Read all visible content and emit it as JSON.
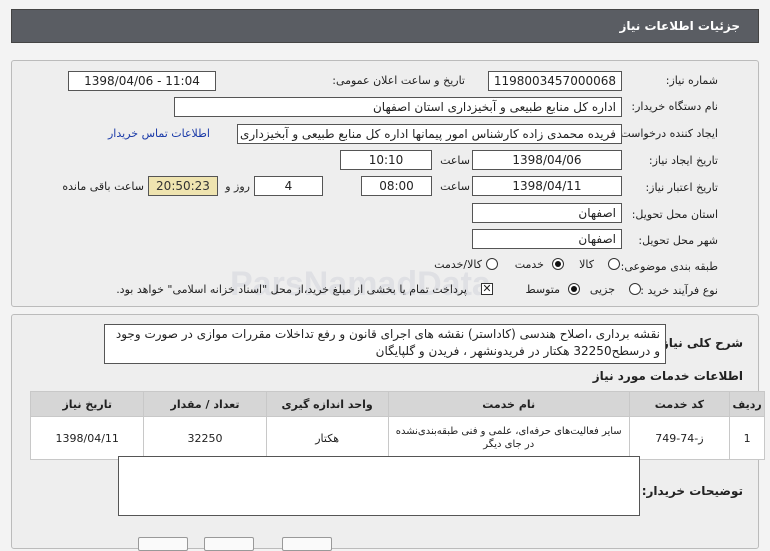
{
  "header": {
    "title": "جزئیات اطلاعات نیاز"
  },
  "fields": {
    "need_number_label": "شماره نیاز:",
    "need_number": "1198003457000068",
    "announce_label": "تاریخ و ساعت اعلان عمومی:",
    "announce_value": "1398/04/06 - 11:04",
    "buyer_org_label": "نام دستگاه خریدار:",
    "buyer_org": "اداره کل منابع طبیعی و آبخیزداری استان اصفهان",
    "creator_label": "ایجاد کننده درخواست:",
    "creator": "فریده محمدی زاده کارشناس امور پیمانها اداره کل منابع طبیعی و آبخیزداری استان",
    "contact_link": "اطلاعات تماس خریدار",
    "created_date_label": "تاریخ ایجاد نیاز:",
    "created_date": "1398/04/06",
    "time_label": "ساعت",
    "created_time": "10:10",
    "validity_label": "تاریخ اعتبار نیاز:",
    "validity_date": "1398/04/11",
    "validity_time": "08:00",
    "days_value": "4",
    "days_label": "روز و",
    "remaining_time": "20:50:23",
    "remaining_label": "ساعت باقی مانده",
    "province_label": "استان محل تحویل:",
    "province": "اصفهان",
    "city_label": "شهر محل تحویل:",
    "city": "اصفهان",
    "category_label": "طبقه بندی موضوعی:",
    "category_options": [
      "کالا",
      "خدمت",
      "کالا/خدمت"
    ],
    "process_label": "نوع فرآیند خرید :",
    "process_options": [
      "جزیی",
      "متوسط"
    ],
    "payment_note": "پرداخت تمام یا بخشی از مبلغ خرید،از محل \"اسناد خزانه اسلامی\" خواهد بود."
  },
  "description": {
    "label": "شرح کلی نیاز:",
    "text": "نقشه برداری ،اصلاح هندسی (کاداستر) نقشه های اجرای قانون و رفع تداخلات مقررات موازی در صورت وجود و درسطح32250 هکتار در فریدونشهر ، فریدن و گلپایگان"
  },
  "services": {
    "title": "اطلاعات خدمات مورد نیاز",
    "columns": [
      "ردیف",
      "کد خدمت",
      "نام خدمت",
      "واحد اندازه گیری",
      "تعداد / مقدار",
      "تاریخ نیاز"
    ],
    "rows": [
      {
        "row": "1",
        "code": "ز-74-749",
        "name": "سایر فعالیت‌های حرفه‌ای، علمی و فنی طبقه‌بندی‌نشده در جای دیگر",
        "unit": "هکتار",
        "qty": "32250",
        "date": "1398/04/11"
      }
    ]
  },
  "buyer_notes": {
    "label": "توضیحات خریدار:",
    "text": ""
  },
  "watermark": "ParsNamadData"
}
